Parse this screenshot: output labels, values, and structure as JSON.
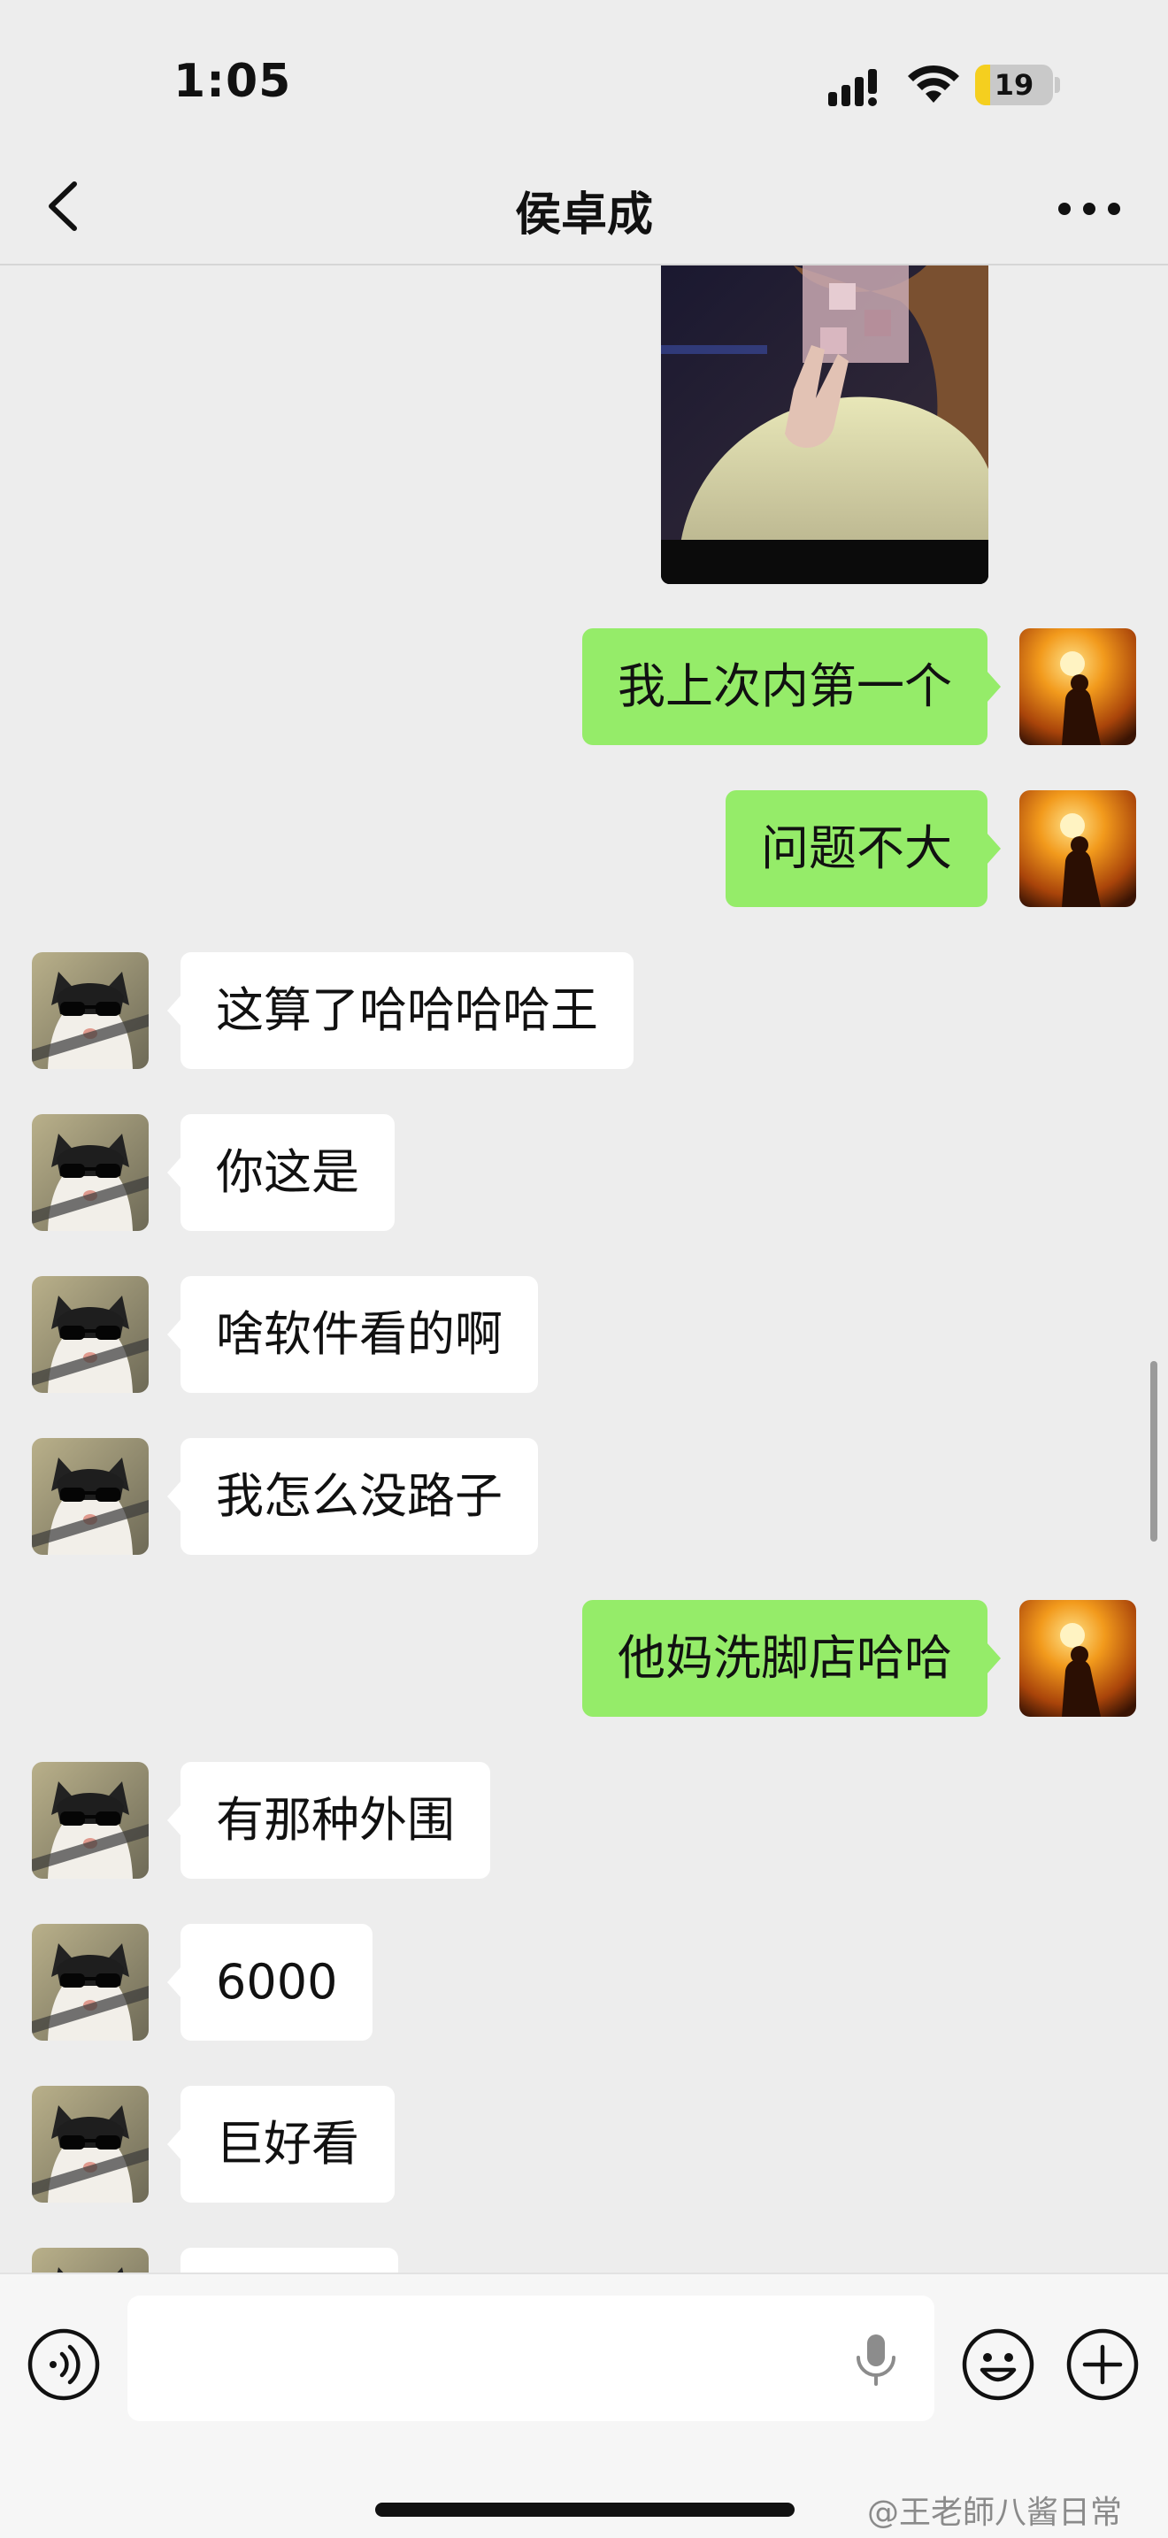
{
  "status_bar": {
    "time": "1:05",
    "battery_level": "19",
    "battery_fraction": 0.19
  },
  "header": {
    "title": "侯卓成"
  },
  "messages": [
    {
      "side": "right",
      "text": "我上次内第一个"
    },
    {
      "side": "right",
      "text": "问题不大"
    },
    {
      "side": "left",
      "text": "这算了哈哈哈哈王"
    },
    {
      "side": "left",
      "text": "你这是"
    },
    {
      "side": "left",
      "text": "啥软件看的啊"
    },
    {
      "side": "left",
      "text": "我怎么没路子"
    },
    {
      "side": "right",
      "text": "他妈洗脚店哈哈"
    },
    {
      "side": "left",
      "text": "有那种外围"
    },
    {
      "side": "left",
      "text": "6000"
    },
    {
      "side": "left",
      "text": "巨好看"
    }
  ],
  "input": {
    "placeholder": ""
  },
  "watermark": "@王老師八酱日常",
  "icons": {
    "back": "chevron-left-icon",
    "more": "ellipsis-icon",
    "voice": "voice-wave-icon",
    "mic": "microphone-icon",
    "emoji": "smiley-icon",
    "plus": "plus-circle-icon"
  },
  "colors": {
    "outgoing_bubble": "#95ec69",
    "incoming_bubble": "#ffffff",
    "background": "#ededed"
  }
}
